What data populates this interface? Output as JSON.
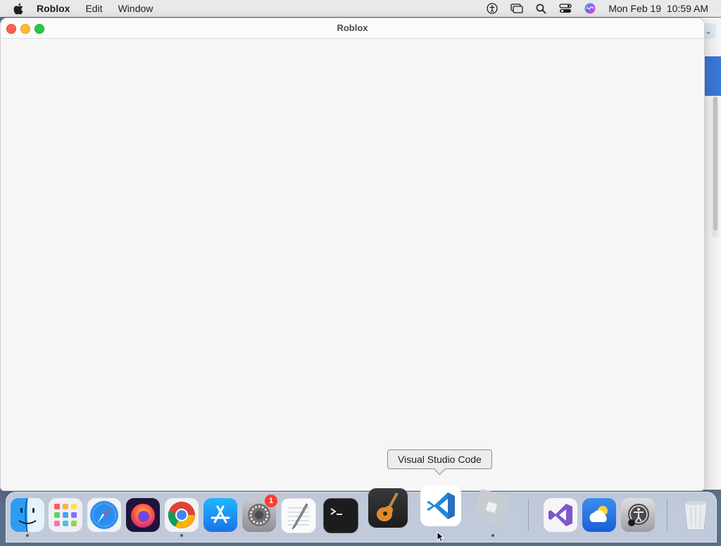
{
  "menubar": {
    "app_name": "Roblox",
    "menus": [
      "Edit",
      "Window"
    ],
    "datetime": "Mon Feb 19  10:59 AM",
    "status_icons": [
      "accessibility-icon",
      "screen-mirroring-icon",
      "spotlight-search-icon",
      "control-center-icon",
      "siri-icon"
    ]
  },
  "window": {
    "title": "Roblox"
  },
  "tooltip": {
    "text": "Visual Studio Code"
  },
  "dock": {
    "apps": [
      {
        "name": "Finder",
        "icon": "finder-icon",
        "running": true
      },
      {
        "name": "Launchpad",
        "icon": "launchpad-icon",
        "running": false
      },
      {
        "name": "Safari",
        "icon": "safari-icon",
        "running": false
      },
      {
        "name": "Firefox",
        "icon": "firefox-icon",
        "running": false
      },
      {
        "name": "Google Chrome",
        "icon": "chrome-icon",
        "running": true
      },
      {
        "name": "App Store",
        "icon": "app-store-icon",
        "running": false
      },
      {
        "name": "System Settings",
        "icon": "settings-icon",
        "running": false,
        "badge": "1"
      },
      {
        "name": "TextEdit",
        "icon": "textedit-icon",
        "running": false
      },
      {
        "name": "Terminal",
        "icon": "terminal-icon",
        "running": false
      },
      {
        "name": "GarageBand",
        "icon": "garageband-icon",
        "running": false
      },
      {
        "name": "Visual Studio Code",
        "icon": "vscode-icon",
        "running": false
      },
      {
        "name": "Roblox",
        "icon": "roblox-icon",
        "running": true
      },
      {
        "name": "Visual Studio",
        "icon": "visual-studio-icon",
        "running": false
      },
      {
        "name": "Weather",
        "icon": "weather-icon",
        "running": false
      },
      {
        "name": "Accessibility Inspector",
        "icon": "accessibility-inspector-icon",
        "running": false
      },
      {
        "name": "Trash",
        "icon": "trash-icon",
        "running": false
      }
    ]
  },
  "colors": {
    "close": "#fe5f57",
    "minimize": "#febc2e",
    "maximize": "#28c840",
    "badge": "#ff3b30"
  }
}
